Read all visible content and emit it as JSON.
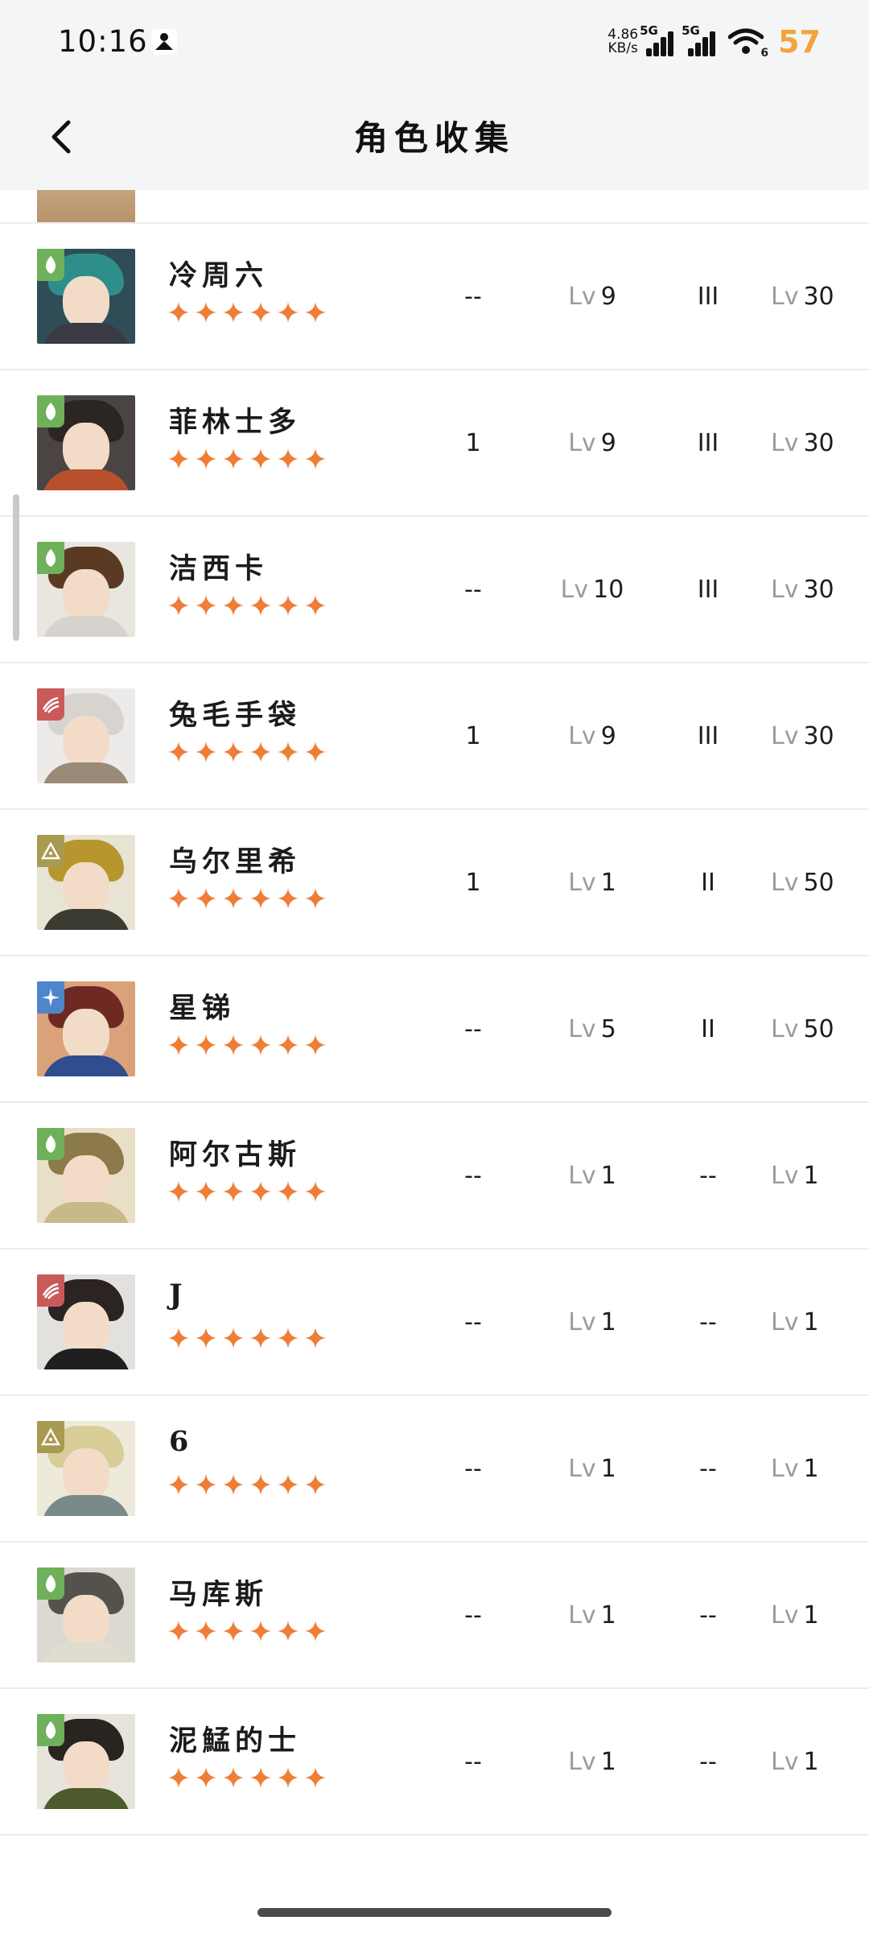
{
  "status_bar": {
    "time": "10:16",
    "net_speed_value": "4.86",
    "net_speed_unit": "KB/s",
    "signal_1_tag": "5G",
    "signal_2_tag": "5G",
    "wifi_tag": "6",
    "battery": "57",
    "battery_color": "#f3a43a"
  },
  "header": {
    "title": "角色收集",
    "back_icon": "chevron-left-icon"
  },
  "star_color": "#ef7d36",
  "characters": [
    {
      "name": "冷周六",
      "element": "leaf",
      "element_color": "#6fb05a",
      "stars": 6,
      "col_a": "--",
      "level_prefix": "Lv",
      "level": "9",
      "rank": "III",
      "level2_prefix": "Lv",
      "level2": "30",
      "avatar_colors": {
        "bg": "#2f4d57",
        "hair": "#2e8f8a",
        "body": "#3a3a44"
      }
    },
    {
      "name": "菲林士多",
      "element": "leaf",
      "element_color": "#6fb05a",
      "stars": 6,
      "col_a": "1",
      "level_prefix": "Lv",
      "level": "9",
      "rank": "III",
      "level2_prefix": "Lv",
      "level2": "30",
      "avatar_colors": {
        "bg": "#4a4542",
        "hair": "#2b2624",
        "body": "#b8502e"
      }
    },
    {
      "name": "洁西卡",
      "element": "leaf",
      "element_color": "#6fb05a",
      "stars": 6,
      "col_a": "--",
      "level_prefix": "Lv",
      "level": "10",
      "rank": "III",
      "level2_prefix": "Lv",
      "level2": "30",
      "avatar_colors": {
        "bg": "#e9e5df",
        "hair": "#5a3a22",
        "body": "#d6d3cd"
      }
    },
    {
      "name": "兔毛手袋",
      "element": "claw",
      "element_color": "#c95a5a",
      "stars": 6,
      "col_a": "1",
      "level_prefix": "Lv",
      "level": "9",
      "rank": "III",
      "level2_prefix": "Lv",
      "level2": "30",
      "avatar_colors": {
        "bg": "#ecebea",
        "hair": "#d7d4d0",
        "body": "#9a8a78"
      }
    },
    {
      "name": "乌尔里希",
      "element": "rock",
      "element_color": "#a99a52",
      "stars": 6,
      "col_a": "1",
      "level_prefix": "Lv",
      "level": "1",
      "rank": "II",
      "level2_prefix": "Lv",
      "level2": "50",
      "avatar_colors": {
        "bg": "#e8e4d4",
        "hair": "#b8962e",
        "body": "#3b3b32"
      }
    },
    {
      "name": "星锑",
      "element": "star",
      "element_color": "#4f86c9",
      "stars": 6,
      "col_a": "--",
      "level_prefix": "Lv",
      "level": "5",
      "rank": "II",
      "level2_prefix": "Lv",
      "level2": "50",
      "avatar_colors": {
        "bg": "#d9a27a",
        "hair": "#6e2a22",
        "body": "#2f4d8f"
      }
    },
    {
      "name": "阿尔古斯",
      "element": "leaf",
      "element_color": "#6fb05a",
      "stars": 6,
      "col_a": "--",
      "level_prefix": "Lv",
      "level": "1",
      "rank": "--",
      "level2_prefix": "Lv",
      "level2": "1",
      "avatar_colors": {
        "bg": "#e9dfc7",
        "hair": "#8c7a4a",
        "body": "#c9b98a"
      }
    },
    {
      "name": "J",
      "element": "claw",
      "element_color": "#c95a5a",
      "stars": 6,
      "col_a": "--",
      "level_prefix": "Lv",
      "level": "1",
      "rank": "--",
      "level2_prefix": "Lv",
      "level2": "1",
      "avatar_colors": {
        "bg": "#e3e1de",
        "hair": "#2b2422",
        "body": "#1f1f1f"
      }
    },
    {
      "name": "6",
      "element": "rock",
      "element_color": "#a99a52",
      "stars": 6,
      "col_a": "--",
      "level_prefix": "Lv",
      "level": "1",
      "rank": "--",
      "level2_prefix": "Lv",
      "level2": "1",
      "avatar_colors": {
        "bg": "#eeeadb",
        "hair": "#d9cd98",
        "body": "#7a8a8a"
      }
    },
    {
      "name": "马库斯",
      "element": "leaf",
      "element_color": "#6fb05a",
      "stars": 6,
      "col_a": "--",
      "level_prefix": "Lv",
      "level": "1",
      "rank": "--",
      "level2_prefix": "Lv",
      "level2": "1",
      "avatar_colors": {
        "bg": "#dcd9d2",
        "hair": "#55524d",
        "body": "#e0dccf"
      }
    },
    {
      "name": "泥鯭的士",
      "element": "leaf",
      "element_color": "#6fb05a",
      "stars": 6,
      "col_a": "--",
      "level_prefix": "Lv",
      "level": "1",
      "rank": "--",
      "level2_prefix": "Lv",
      "level2": "1",
      "avatar_colors": {
        "bg": "#e7e4dc",
        "hair": "#2a2421",
        "body": "#4c5a2e"
      }
    }
  ]
}
